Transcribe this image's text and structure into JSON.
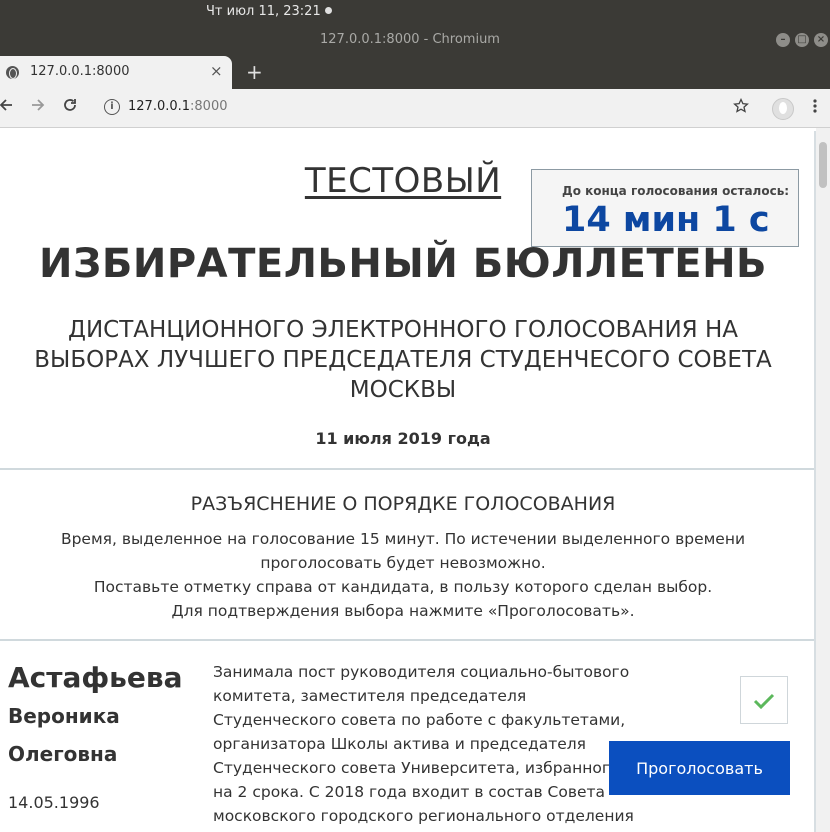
{
  "os": {
    "clock": "Чт июл 11, 23:21"
  },
  "window": {
    "title": "127.0.0.1:8000 - Chromium"
  },
  "browser": {
    "tab_title": "127.0.0.1:8000",
    "tab_close": "×",
    "new_tab": "+",
    "url_host": "127.0.0.1",
    "url_port": ":8000",
    "icons": [
      "back-arrow-icon",
      "forward-arrow-icon",
      "reload-icon",
      "info-icon",
      "star-icon",
      "profile-avatar-icon",
      "kebab-menu-icon"
    ]
  },
  "ballot": {
    "test_label": "ТЕСТОВЫЙ",
    "timer_caption": "До конца голосования осталось:",
    "timer_value": "14 мин 1 с",
    "title": "ИЗБИРАТЕЛЬНЫЙ БЮЛЛЕТЕНЬ",
    "subtitle": "ДИСТАНЦИОННОГО ЭЛЕКТРОННОГО ГОЛОСОВАНИЯ НА ВЫБОРАХ ЛУЧШЕГО ПРЕДСЕДАТЕЛЯ СТУДЕНЧЕСОГО СОВЕТА МОСКВЫ",
    "date": "11 июля 2019 года"
  },
  "explanation": {
    "heading": "РАЗЪЯСНЕНИЕ О ПОРЯДКЕ ГОЛОСОВАНИЯ",
    "lines": [
      "Время, выделенное на голосование 15 минут. По истечении выделенного времени проголосовать будет невозможно.",
      "Поставьте отметку справа от кандидата, в пользу которого сделан выбор.",
      "Для подтверждения выбора нажмите «Проголосовать»."
    ]
  },
  "candidate": {
    "surname": "Астафьева",
    "name": "Вероника",
    "patronymic": "Олеговна",
    "dob": "14.05.1996",
    "bio": "Занимала пост руководителя социально-бытового комитета, заместителя председателя Студенческого совета по работе с факультетами, организатора Школы актива и председателя Студенческого совета Университета, избранного на 2 срока. С 2018 года входит в состав Совета московского городского регионального отделения общероссийского",
    "selected": true
  },
  "actions": {
    "vote_label": "Проголосовать"
  },
  "colors": {
    "accent": "#0b4fbf",
    "timer": "#0d47a1",
    "check": "#5cb85c"
  }
}
